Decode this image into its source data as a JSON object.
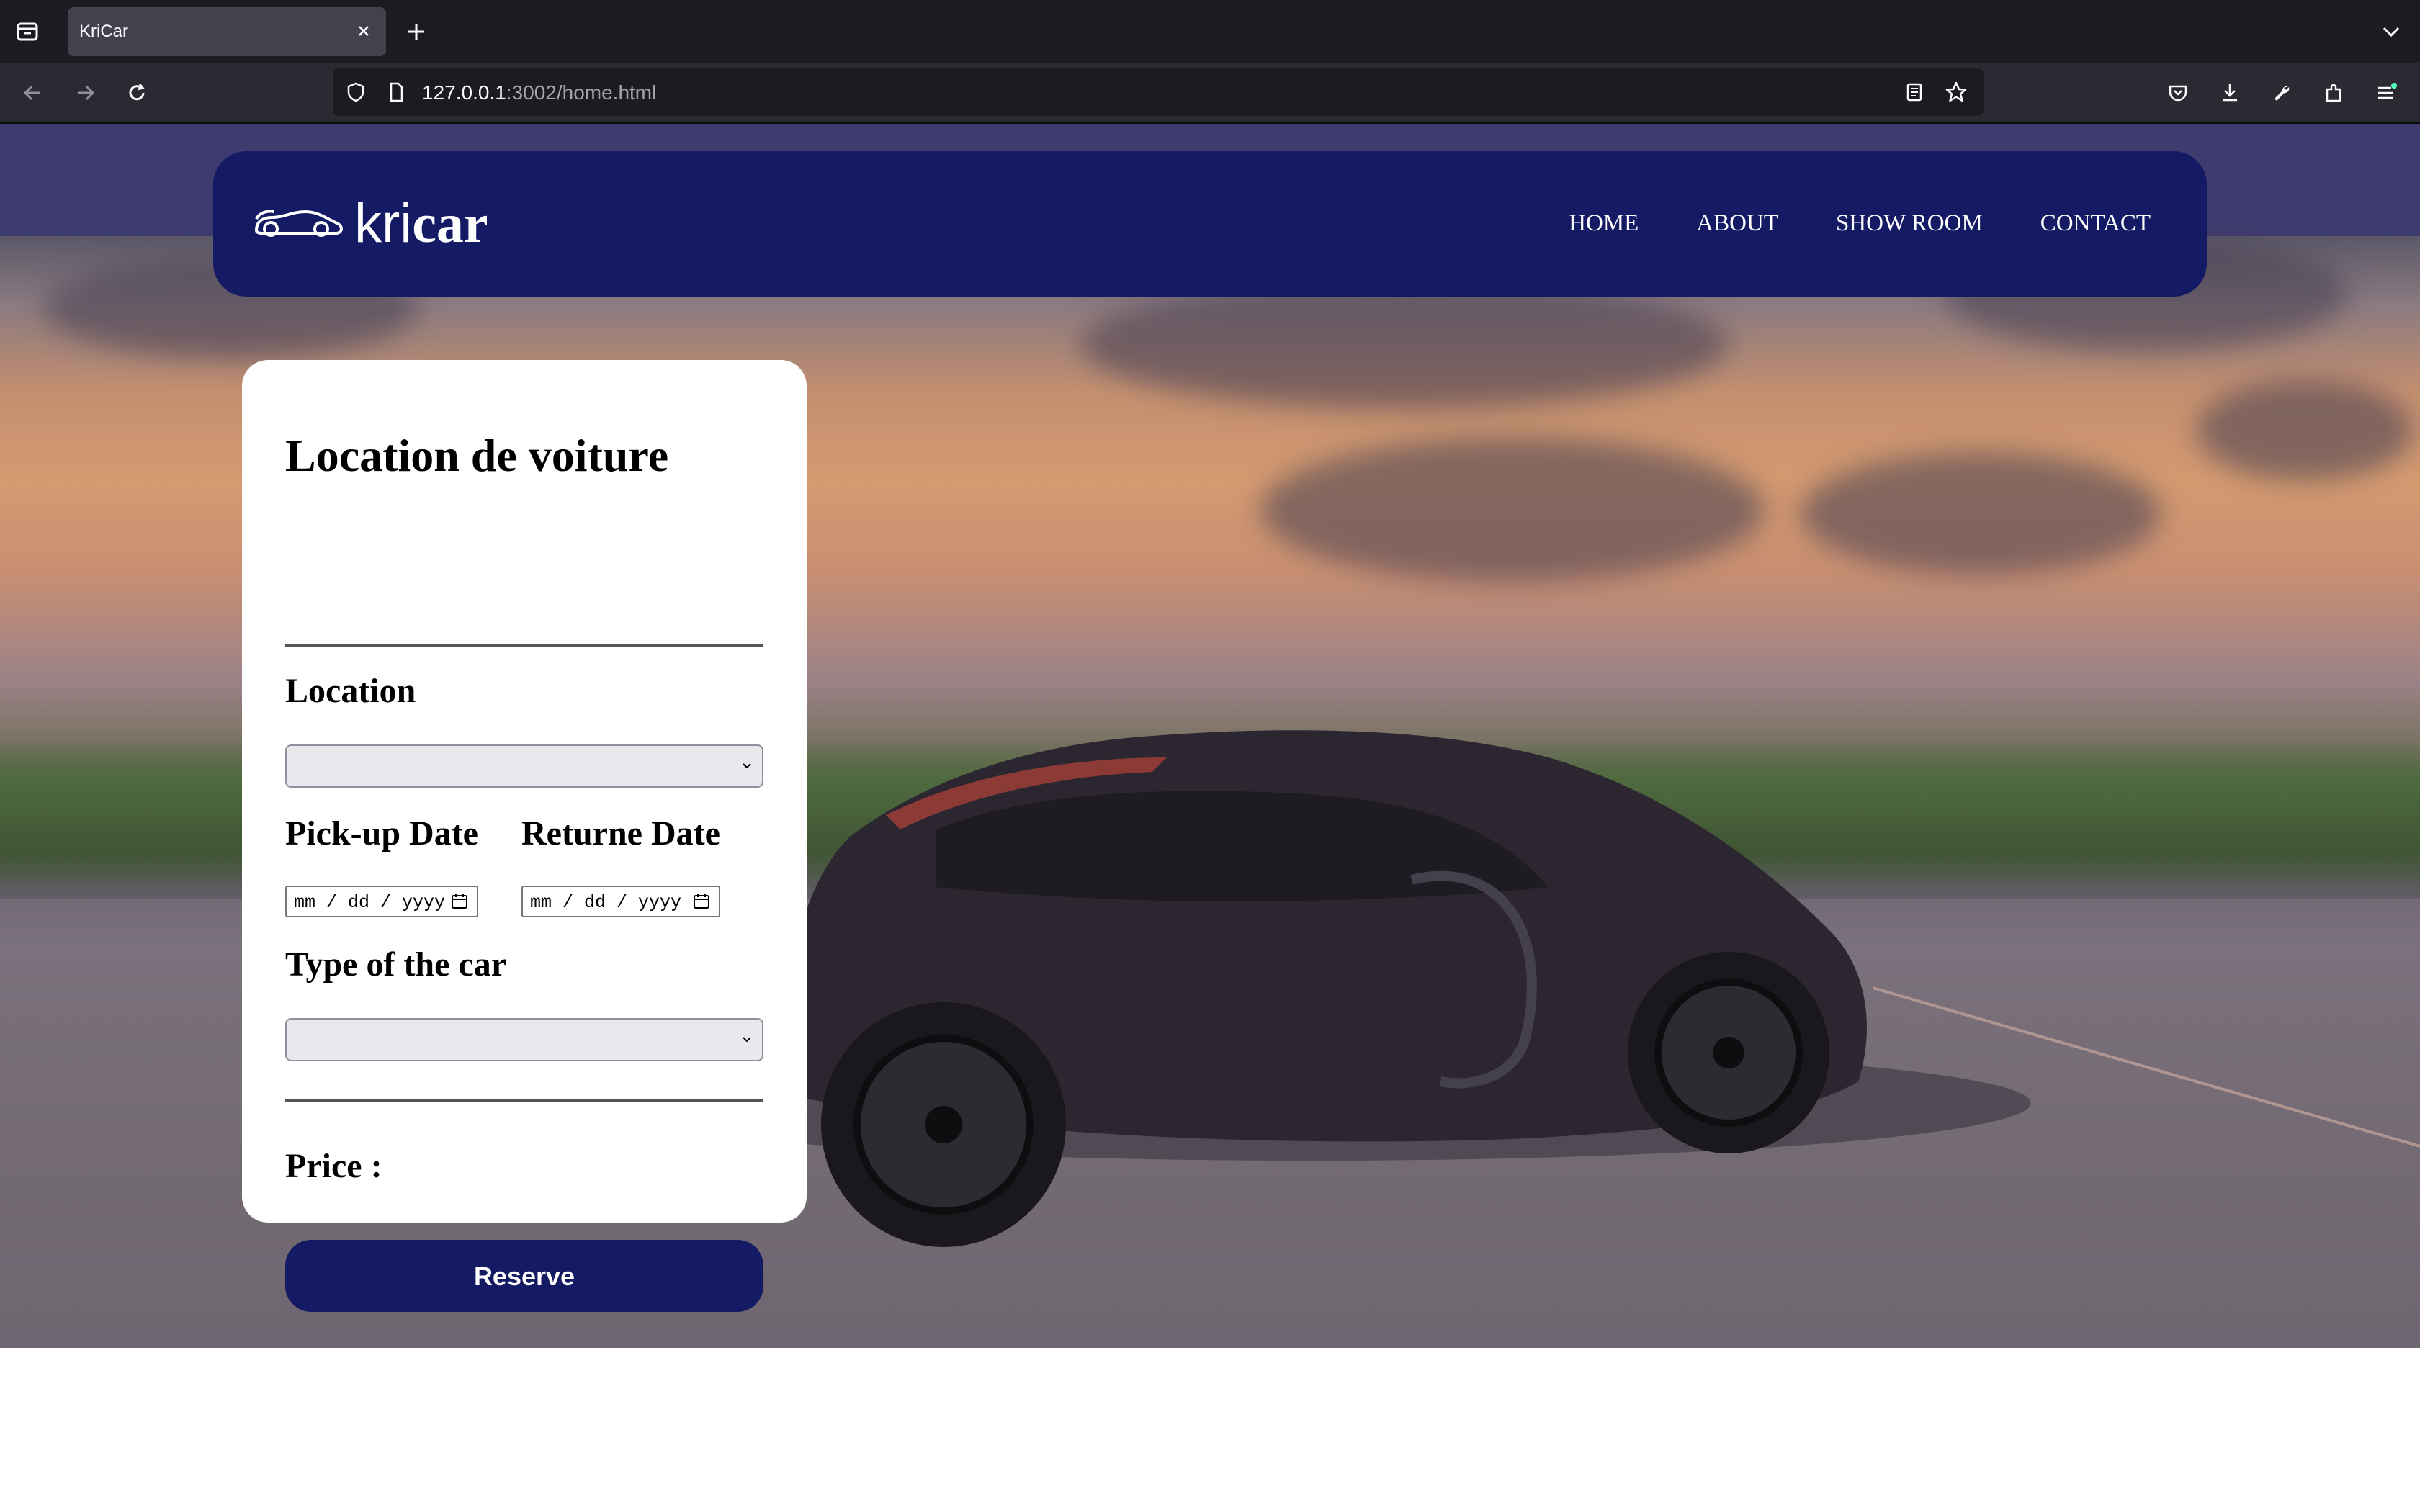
{
  "browser": {
    "tab_title": "KriCar",
    "url_host": "127.0.0.1",
    "url_path": ":3002/home.html"
  },
  "site": {
    "logo_prefix": "kri",
    "logo_suffix": "car",
    "nav": {
      "home": "HOME",
      "about": "ABOUT",
      "showroom": "SHOW ROOM",
      "contact": "CONTACT"
    }
  },
  "form": {
    "title": "Location de voiture",
    "location_label": "Location",
    "location_value": "",
    "pickup_label": "Pick-up Date",
    "return_label": "Returne Date",
    "pickup_placeholder": "mm / dd / yyyy",
    "return_placeholder": "mm / dd / yyyy",
    "car_type_label": "Type of the car",
    "car_type_value": "",
    "price_label": "Price :",
    "reserve_label": "Reserve"
  },
  "colors": {
    "brand_navy": "#141a63",
    "header_band": "#3e3b70"
  }
}
